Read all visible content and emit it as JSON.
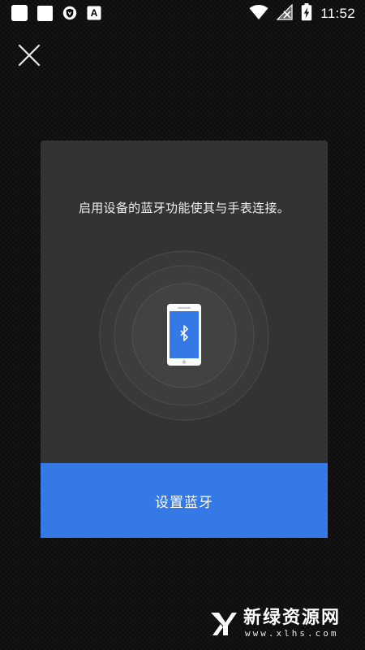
{
  "status_bar": {
    "time": "11:52",
    "left_icons": [
      "notification-square-icon",
      "notification-square-icon",
      "shield-app-icon",
      "font-app-icon"
    ],
    "right_icons": [
      "wifi-icon",
      "no-sim-icon",
      "battery-charging-icon"
    ],
    "font_app_glyph": "A"
  },
  "dialog": {
    "message": "启用设备的蓝牙功能使其与手表连接。",
    "button_label": "设置蓝牙",
    "illustration": "phone-bluetooth-icon"
  },
  "close_icon": "close-icon",
  "watermark": {
    "title": "新绿资源网",
    "url": "www.xlhs.com"
  },
  "colors": {
    "accent": "#3579e6",
    "dialog_background": "#333333",
    "page_background": "#141414",
    "phone_screen": "#3579e6"
  }
}
